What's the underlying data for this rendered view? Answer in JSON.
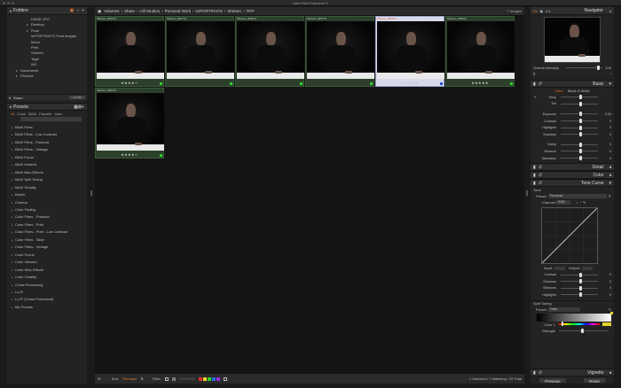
{
  "window": {
    "title": "Alien Skin Exposure X"
  },
  "folders": {
    "title": "Folders",
    "items": [
      {
        "label": "DAVID JPG",
        "indent": 0,
        "tri": ""
      },
      {
        "label": "Desktop",
        "indent": 0,
        "tri": "▸"
      },
      {
        "label": "Final",
        "indent": 0,
        "tri": "▸"
      },
      {
        "label": "imPORTRAITS Final Images",
        "indent": 0,
        "tri": ""
      },
      {
        "label": "Moon",
        "indent": 0,
        "tri": ""
      },
      {
        "label": "Print",
        "indent": 0,
        "tri": ""
      },
      {
        "label": "Shireen",
        "indent": 0,
        "tri": ""
      },
      {
        "label": "Tagtt",
        "indent": 0,
        "tri": ""
      },
      {
        "label": "WC",
        "indent": 0,
        "tri": ""
      },
      {
        "label": "Documents",
        "indent": -2,
        "tri": "▸"
      },
      {
        "label": "Pictures",
        "indent": -2,
        "tri": "▸"
      }
    ],
    "share_label": "Share",
    "share_size": "2.5 TB"
  },
  "presets": {
    "title": "Presets",
    "tabs": [
      "All",
      "Color",
      "B&W",
      "Favorite",
      "User"
    ],
    "active_tab": "All",
    "items": [
      "B&W Films",
      "B&W Films - Low Contrast",
      "B&W Films - Polaroid",
      "B&W Films - Vintage",
      "B&W Focus",
      "B&W Infrared",
      "B&W Misc Effects",
      "B&W Split Toning",
      "B&W Tonality",
      "Bokeh",
      "Cinema",
      "Color Fading",
      "Color Films - Polaroid",
      "Color Films - Print",
      "Color Films - Print - Low Contrast",
      "Color Films - Slide",
      "Color Films - Vintage",
      "Color Focus",
      "Color Infrared",
      "Color Misc Effects",
      "Color Tonality",
      "Cross Processing",
      "Lo-Fi",
      "Lo-Fi (Cross Processed)",
      "My Presets"
    ]
  },
  "breadcrumb": {
    "items": [
      "Volumes",
      "Share",
      "Hill Studios",
      "Personal Work",
      "imPORTRAITS",
      "Shireen",
      "TIFF"
    ],
    "count": "7 Images"
  },
  "thumbnails": [
    {
      "name": "Shireen_0023.tif",
      "stars": "★★★★☆",
      "selected": false
    },
    {
      "name": "Shireen_0027.tif",
      "stars": "",
      "selected": false
    },
    {
      "name": "Shireen_0036.tif",
      "stars": "",
      "selected": false
    },
    {
      "name": "Shireen_0037.tif",
      "stars": "",
      "selected": false
    },
    {
      "name": "Shireen_0039.tif",
      "stars": "☆☆☆☆☆",
      "selected": true
    },
    {
      "name": "Shireen_0050.tif",
      "stars": "★★★★★",
      "selected": false
    },
    {
      "name": "Shireen_0063.tif",
      "stars": "★★★★☆",
      "selected": false
    }
  ],
  "bottombar": {
    "sort_label": "Sort:",
    "sort_value": "Filename",
    "filter_label": "Filter:",
    "filter_stars": "☆☆☆☆☆",
    "swatches": [
      "#e52a2a",
      "#e5d52a",
      "#2ad02a",
      "#2a6ae5",
      "#9a2ae5"
    ],
    "status": "1 Selected / 7 Matching / 32 Total"
  },
  "navigator": {
    "title": "Navigator",
    "fit": "Fit",
    "ratio": "1:1",
    "overall_intensity_label": "Overall Intensity",
    "overall_intensity_value": "100"
  },
  "basic": {
    "title": "Basic",
    "mode_color": "Color",
    "mode_bw": "Black & White",
    "sliders": [
      {
        "label": "Temp",
        "value": "",
        "pos": 0.5
      },
      {
        "label": "Tint",
        "value": "",
        "pos": 0.5
      },
      {
        "label": "Exposure",
        "value": "0.00",
        "pos": 0.5
      },
      {
        "label": "Contrast",
        "value": "0",
        "pos": 0.5
      },
      {
        "label": "Highlights",
        "value": "0",
        "pos": 0.5
      },
      {
        "label": "Shadows",
        "value": "0",
        "pos": 0.5
      },
      {
        "label": "Clarity",
        "value": "0",
        "pos": 0.5
      },
      {
        "label": "Vibrance",
        "value": "0",
        "pos": 0.5
      },
      {
        "label": "Saturation",
        "value": "0",
        "pos": 0.5
      }
    ]
  },
  "detail": {
    "title": "Detail"
  },
  "color": {
    "title": "Color"
  },
  "tone_curve": {
    "title": "Tone Curve",
    "tone_label": "Tone",
    "preset_label": "Preset:",
    "preset_value": "Personal",
    "channel_label": "Channel:",
    "channel_value": "RGB",
    "input_label": "Input:",
    "output_label": "Output:",
    "sliders": [
      {
        "label": "Contrast",
        "value": "0",
        "pos": 0.5
      },
      {
        "label": "Shadows",
        "value": "0",
        "pos": 0.5
      },
      {
        "label": "Midtones",
        "value": "0",
        "pos": 0.5
      },
      {
        "label": "Highlights",
        "value": "0",
        "pos": 0.5
      }
    ]
  },
  "split_toning": {
    "title": "Split Toning",
    "preset_label": "Preset:",
    "preset_value": "Fade",
    "color_label": "Color 1",
    "strength_label": "Strength"
  },
  "vignette": {
    "title": "Vignette"
  },
  "footer": {
    "previous": "Previous",
    "reset": "Reset"
  },
  "colors": {
    "accent": "#e4772b",
    "flag_green": "#2fd02f",
    "flag_blue": "#2f4fd0"
  }
}
